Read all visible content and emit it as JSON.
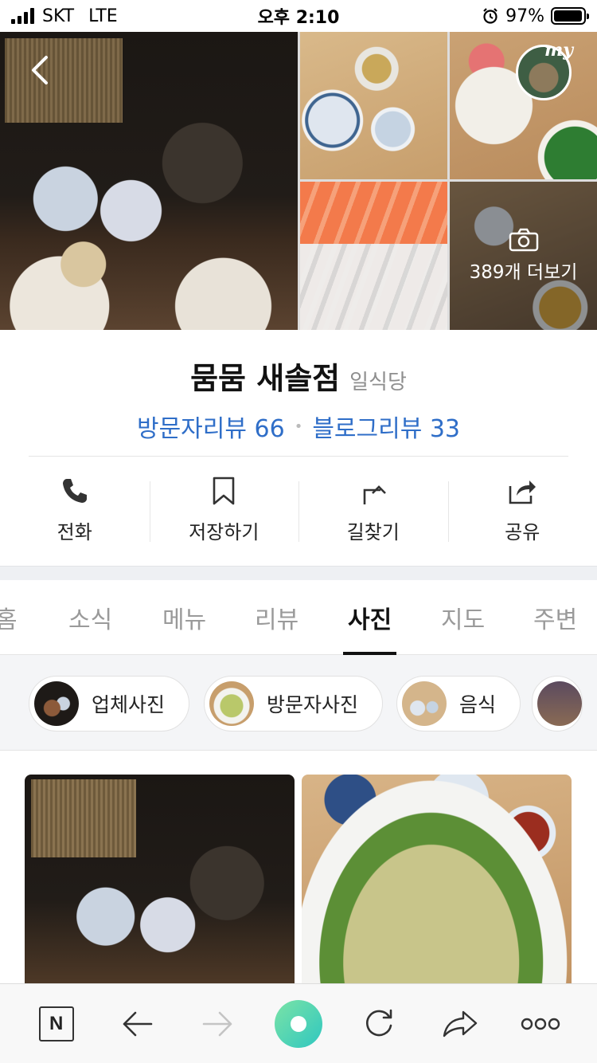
{
  "status_bar": {
    "carrier": "SKT",
    "network": "LTE",
    "time": "오후 2:10",
    "battery": "97%",
    "battery_level": 0.97
  },
  "header_photos": {
    "more_label": "389개 더보기",
    "my_badge": "my"
  },
  "place": {
    "name": "뭄뭄 새솔점",
    "category": "일식당",
    "visitor_reviews": "방문자리뷰 66",
    "blog_reviews": "블로그리뷰 33"
  },
  "actions": [
    {
      "label": "전화",
      "icon": "phone-icon"
    },
    {
      "label": "저장하기",
      "icon": "bookmark-icon"
    },
    {
      "label": "길찾기",
      "icon": "directions-icon"
    },
    {
      "label": "공유",
      "icon": "share-icon"
    }
  ],
  "tabs": [
    {
      "label": "홈"
    },
    {
      "label": "소식"
    },
    {
      "label": "메뉴"
    },
    {
      "label": "리뷰"
    },
    {
      "label": "사진",
      "active": true
    },
    {
      "label": "지도"
    },
    {
      "label": "주변"
    }
  ],
  "photo_filters": [
    {
      "label": "업체사진"
    },
    {
      "label": "방문자사진"
    },
    {
      "label": "음식"
    }
  ],
  "colors": {
    "link_blue": "#2f6ec8",
    "active_tab": "#111111",
    "inactive_tab": "#9a9a9a"
  }
}
